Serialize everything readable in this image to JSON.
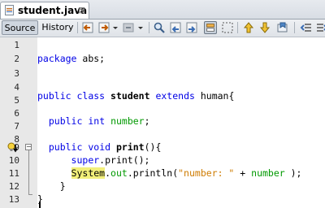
{
  "tab": {
    "title": "student.java",
    "close_glyph": "⊠"
  },
  "toolbar": {
    "source_label": "Source",
    "history_label": "History",
    "icons": [
      "back-icon",
      "forward-icon",
      "next-dropdown-icon",
      "find-icon",
      "find-previous-icon",
      "find-next-icon",
      "toggle-highlight-icon",
      "rectangle-select-icon",
      "previous-bookmark-icon",
      "next-bookmark-icon",
      "toggle-bookmark-icon",
      "shift-left-icon"
    ]
  },
  "colors": {
    "keyword": "#0000e6",
    "string": "#ce7b00",
    "field": "#009900",
    "highlight": "#f3f07a"
  },
  "editor": {
    "line_numbers": [
      "1",
      "2",
      "3",
      "4",
      "5",
      "6",
      "7",
      "8",
      "9",
      "10",
      "11",
      "12",
      "13"
    ],
    "lines": {
      "l2_kw": "package",
      "l2_rest": " abs;",
      "l5_kw1": "public",
      "l5_kw2": "class",
      "l5_name": "student",
      "l5_kw3": "extends",
      "l5_rest": "human{",
      "l7_kw1": "public",
      "l7_kw2": "int",
      "l7_field": "number",
      "l7_semi": ";",
      "l9_kw1": "public",
      "l9_kw2": "void",
      "l9_method": "print",
      "l9_rest": "(){",
      "l10_kw": "super",
      "l10_rest": ".print();",
      "l11_class": "System",
      "l11_dot": ".",
      "l11_out": "out",
      "l11_call": ".println(",
      "l11_str": "\"number: \"",
      "l11_plus": " + ",
      "l11_field": "number",
      "l11_end": " );",
      "l12": "}",
      "l13": "}"
    }
  }
}
